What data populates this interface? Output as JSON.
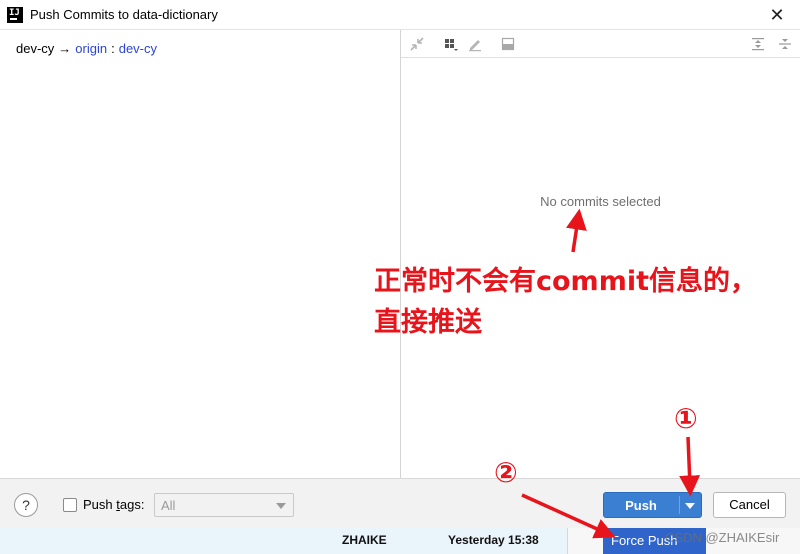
{
  "window": {
    "title": "Push Commits to data-dictionary",
    "app_icon_text": "IJ",
    "close_glyph": "✕"
  },
  "branch": {
    "local": "dev-cy",
    "arrow": "→",
    "remote": "origin",
    "separator": ":",
    "target": "dev-cy"
  },
  "details": {
    "empty_message": "No commits selected",
    "toolbar_icons": [
      "collapse-icon",
      "group-by-icon",
      "edit-icon",
      "diff-preview-icon",
      "expand-all-icon",
      "collapse-all-icon"
    ]
  },
  "footer": {
    "help_glyph": "?",
    "push_tags_prefix": "Push ",
    "push_tags_mnemonic": "t",
    "push_tags_suffix": "ags:",
    "tags_value": "All",
    "push_label": "Push",
    "cancel_label": "Cancel"
  },
  "dropdown_menu": {
    "force_push_label": "Force Push"
  },
  "background_window": {
    "author": "ZHAIKE",
    "date": "Yesterday 15:38"
  },
  "annotations": {
    "line1": "正常时不会有commit信息的，",
    "line2": "直接推送",
    "marker1": "①",
    "marker2": "②",
    "color": "#e8141c"
  },
  "watermark": "CSDN @ZHAIKEsir",
  "colors": {
    "accent": "#3b7fd2",
    "link": "#2c44d6",
    "menu_highlight": "#2f65ca"
  }
}
